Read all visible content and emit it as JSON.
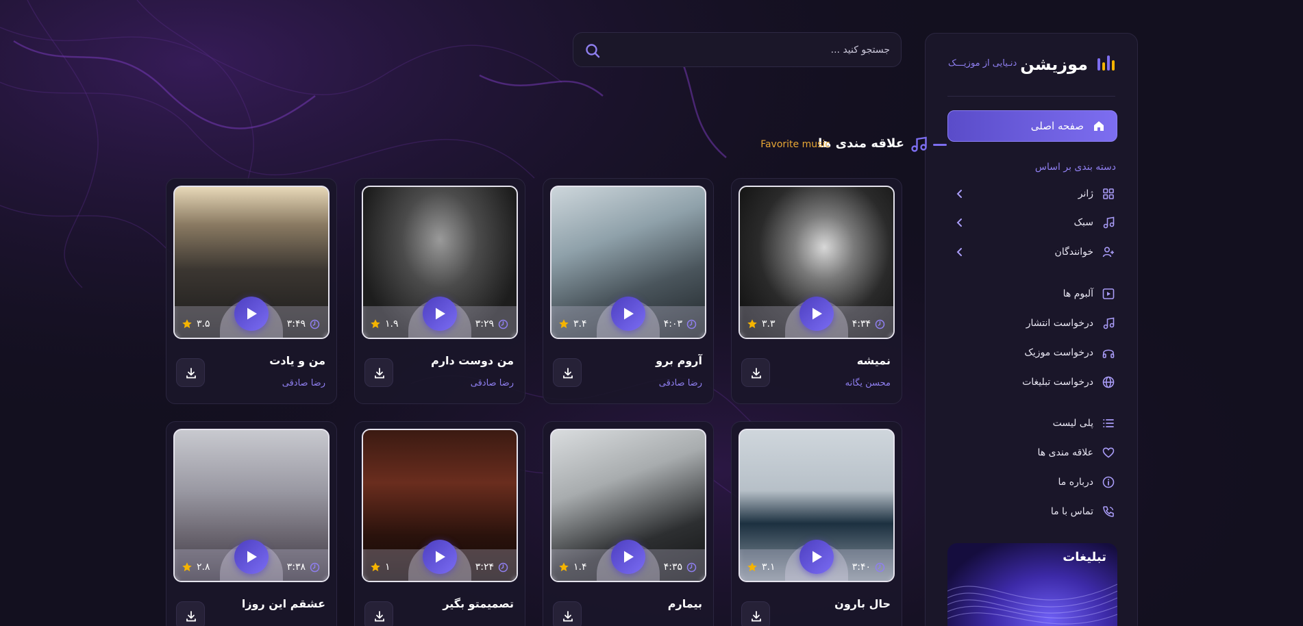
{
  "brand": {
    "name": "موزیشن",
    "tagline": "دنـیایی از موزیـــک"
  },
  "search": {
    "placeholder": "جستجو کنید ..."
  },
  "sidebar": {
    "home_label": "صفحه اصلی",
    "section_label": "دسته بندی بر اساس",
    "categories": [
      {
        "label": "ژانر",
        "icon": "grid-icon"
      },
      {
        "label": "سبک",
        "icon": "music-note-icon"
      },
      {
        "label": "خوانندگان",
        "icon": "user-plus-icon"
      }
    ],
    "group1": [
      {
        "label": "آلبوم ها",
        "icon": "play-square-icon"
      },
      {
        "label": "درخواست انتشار",
        "icon": "music-note-icon"
      },
      {
        "label": "درخواست موزیک",
        "icon": "headphones-icon"
      },
      {
        "label": "درخواست تبلیغات",
        "icon": "globe-icon"
      }
    ],
    "group2": [
      {
        "label": "پلی لیست",
        "icon": "list-icon"
      },
      {
        "label": "علاقه مندی ها",
        "icon": "heart-icon"
      },
      {
        "label": "درباره ما",
        "icon": "info-icon"
      },
      {
        "label": "تماس با ما",
        "icon": "phone-icon"
      }
    ],
    "ads_title": "تبلیغات"
  },
  "section": {
    "title": "علاقه مندی ها",
    "subtitle": "Favorite music"
  },
  "songs": [
    {
      "title": "نمیشه",
      "artist": "محسن یگانه",
      "duration": "۴:۳۴",
      "rating": "۳.۳"
    },
    {
      "title": "آروم برو",
      "artist": "رضا صادقی",
      "duration": "۴:۰۳",
      "rating": "۳.۴"
    },
    {
      "title": "من دوست دارم",
      "artist": "رضا صادقی",
      "duration": "۳:۲۹",
      "rating": "۱.۹"
    },
    {
      "title": "من و یادت",
      "artist": "رضا صادقی",
      "duration": "۳:۴۹",
      "rating": "۳.۵"
    },
    {
      "title": "حال بارون",
      "artist": "",
      "duration": "۳:۴۰",
      "rating": "۳.۱"
    },
    {
      "title": "بیمارم",
      "artist": "",
      "duration": "۴:۳۵",
      "rating": "۱.۴"
    },
    {
      "title": "تصمیمتو بگیر",
      "artist": "",
      "duration": "۳:۲۴",
      "rating": "۱"
    },
    {
      "title": "عشقم این روزا",
      "artist": "",
      "duration": "۳:۳۸",
      "rating": "۲.۸"
    }
  ],
  "colors": {
    "accent": "#7d6ef0",
    "background": "#13101f",
    "panel": "#1a1629",
    "star": "#f5b400",
    "subtitle": "#e8a735"
  }
}
